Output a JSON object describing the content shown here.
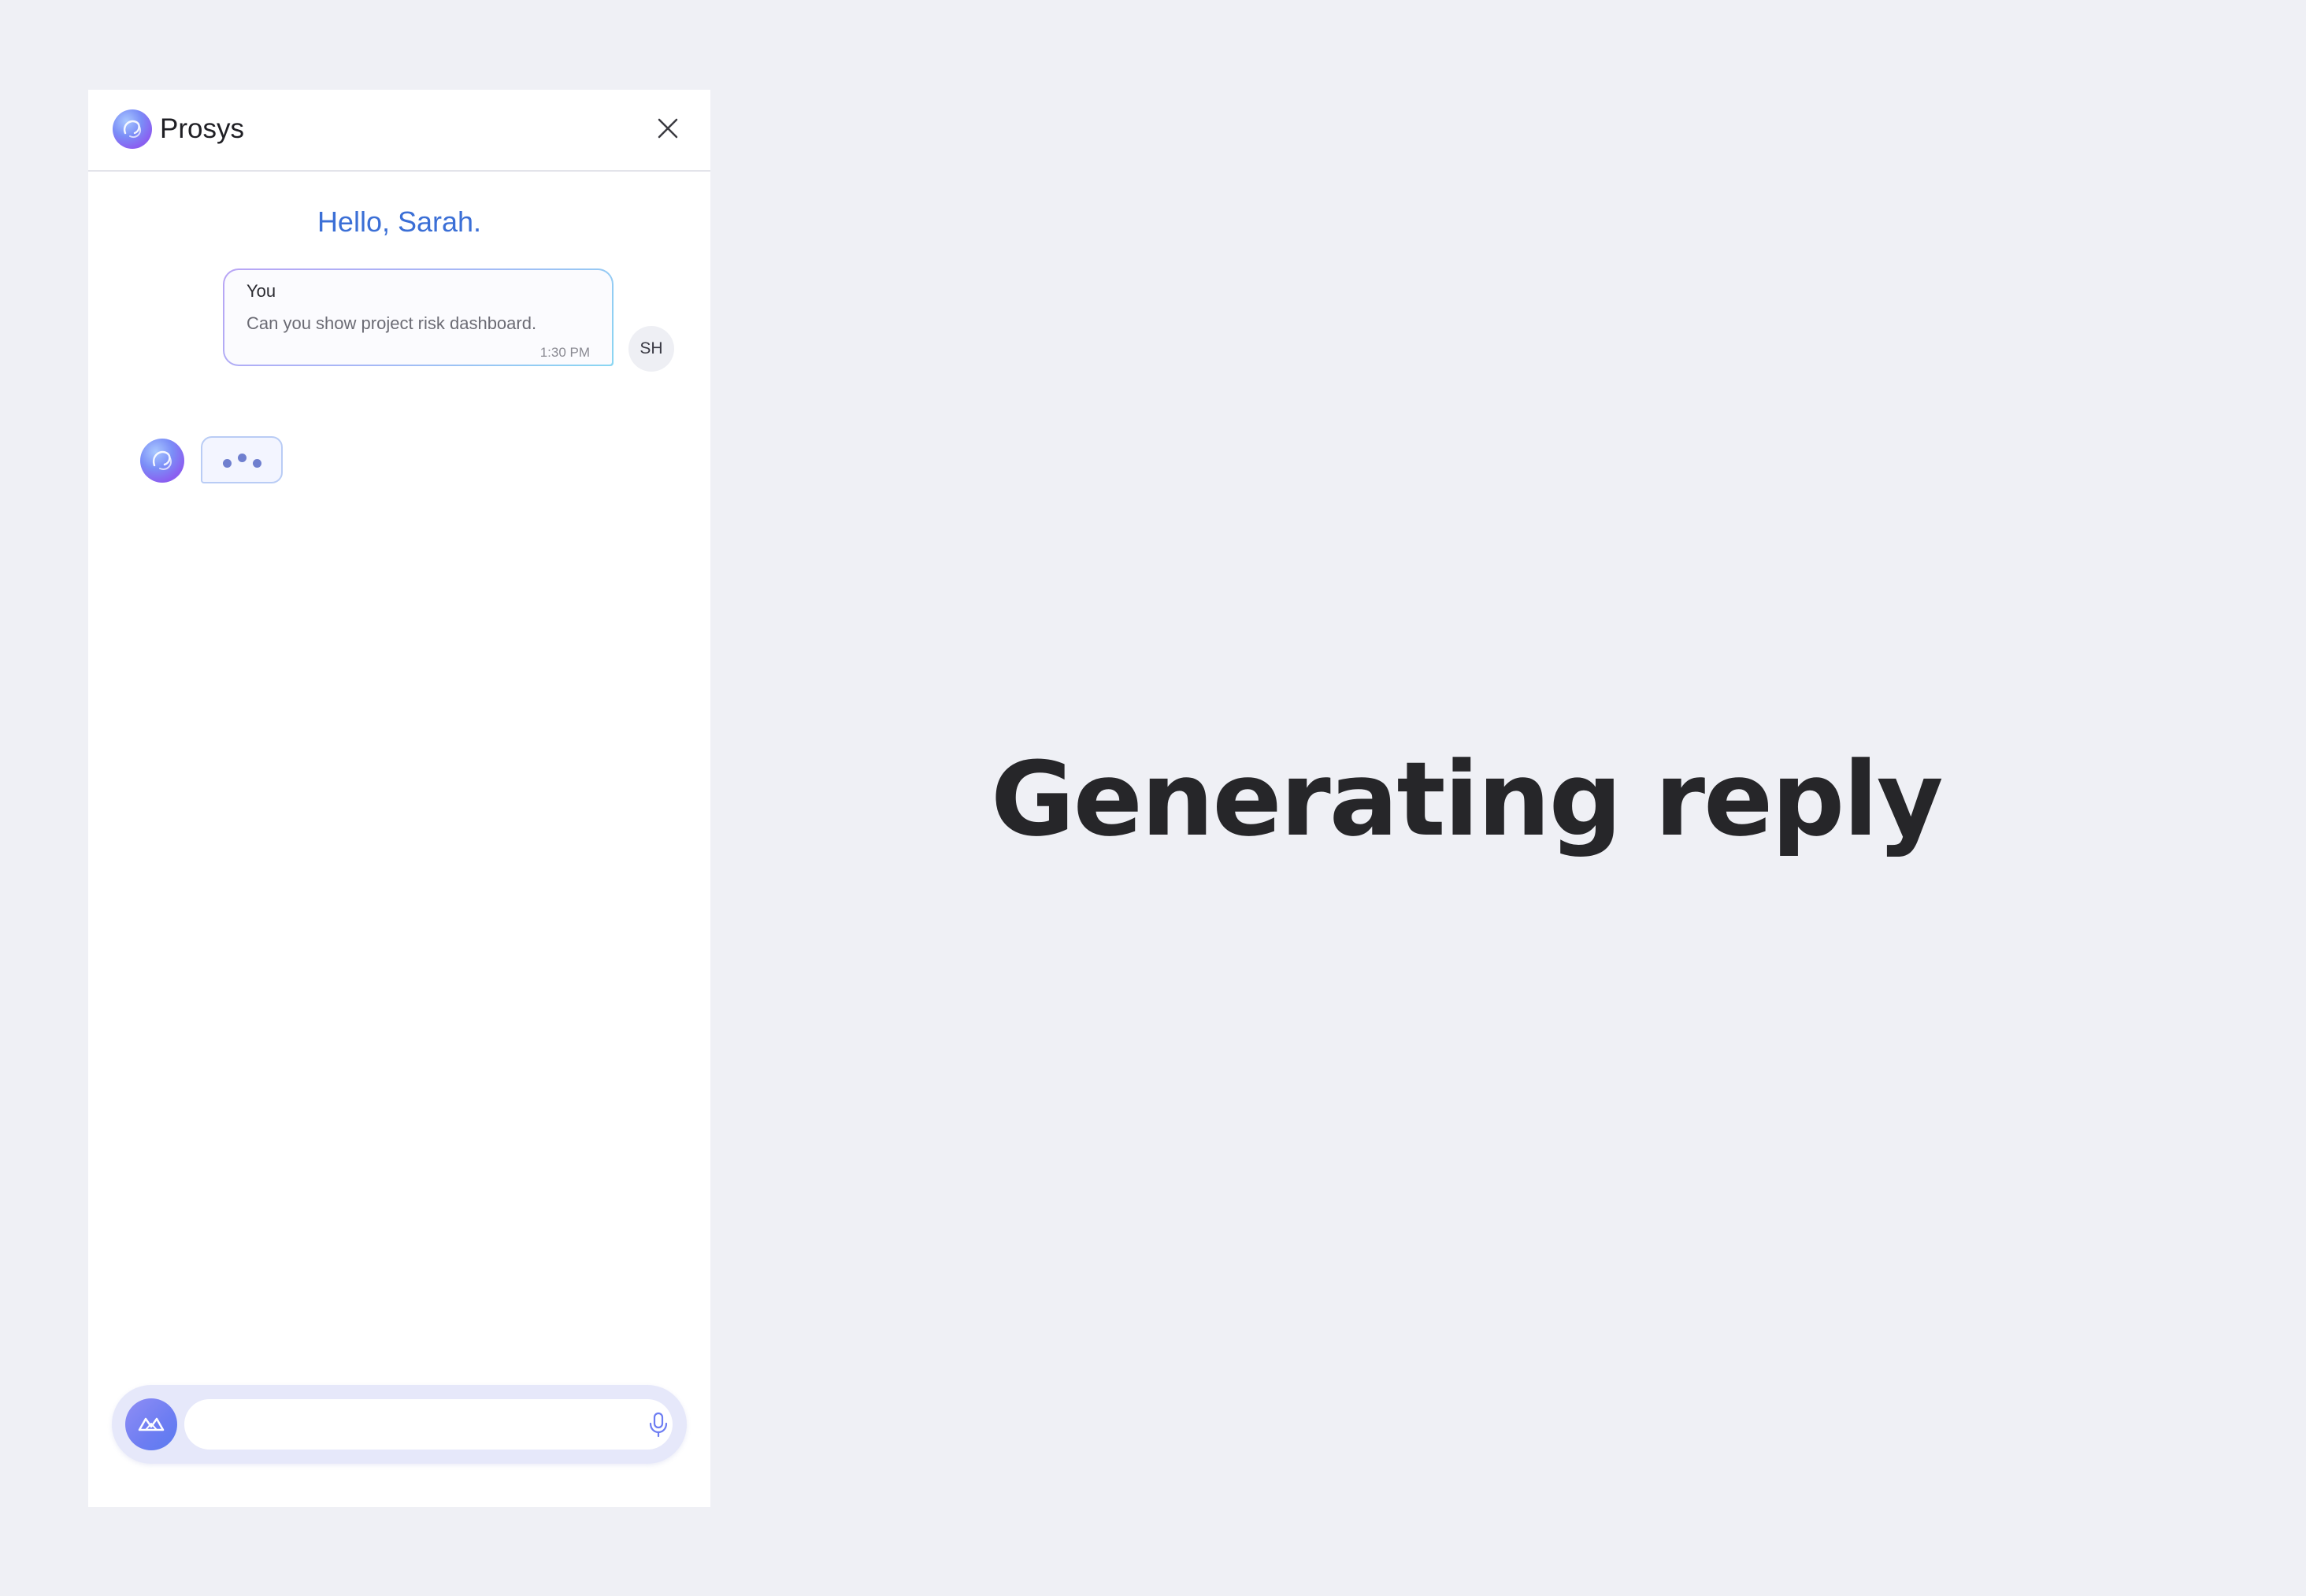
{
  "app": {
    "name": "Prosys"
  },
  "chat": {
    "greeting": "Hello, Sarah.",
    "user_message": {
      "sender": "You",
      "text": "Can you show project risk dashboard.",
      "time": "1:30 PM",
      "avatar_initials": "SH"
    },
    "bot_status": "typing"
  },
  "input": {
    "value": "",
    "placeholder": ""
  },
  "caption": "Generating reply",
  "icons": {
    "logo": "prosys-logo-icon",
    "close": "close-icon",
    "mic": "microphone-icon",
    "assistant": "assistant-logo-icon"
  },
  "colors": {
    "page_background": "#eff0f5",
    "greeting": "#3b6fd6",
    "accent": "#6d7df2",
    "caption": "#262629"
  }
}
